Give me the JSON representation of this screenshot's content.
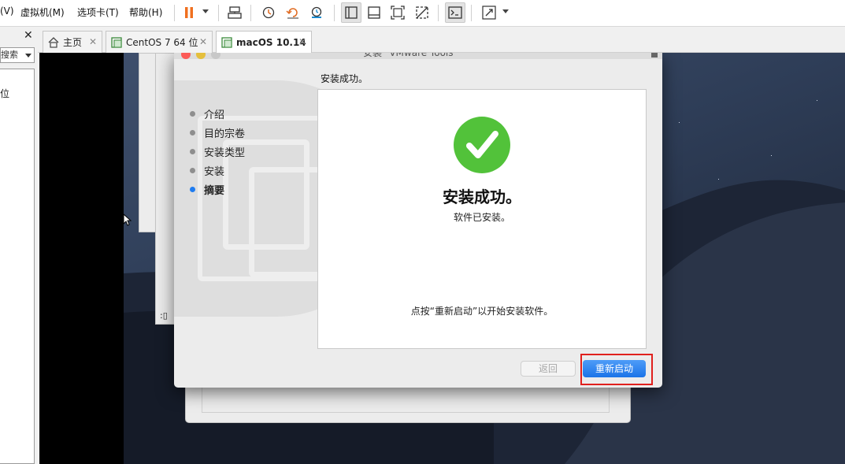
{
  "menu": {
    "items": [
      "(V)",
      "虚拟机(M)",
      "选项卡(T)",
      "帮助(H)"
    ]
  },
  "toolbar": {
    "icons": [
      "pause-icon",
      "send-keys-icon",
      "snapshot-icon",
      "revert-snapshot-icon",
      "snapshot-manager-icon",
      "normal-view-icon",
      "console-view-icon",
      "full-screen-icon",
      "unity-icon",
      "terminal-icon",
      "stretch-icon"
    ]
  },
  "library": {
    "search_placeholder": "搜索",
    "tree_item": "位"
  },
  "tabs": [
    {
      "label": "主页",
      "active": false
    },
    {
      "label": "CentOS 7 64 位",
      "active": false
    },
    {
      "label": "macOS 10.14",
      "active": true
    }
  ],
  "installer": {
    "window_title": "安装 \"VMware Tools\"",
    "heading": "安装成功。",
    "steps": [
      {
        "label": "介绍",
        "current": false
      },
      {
        "label": "目的宗卷",
        "current": false
      },
      {
        "label": "安装类型",
        "current": false
      },
      {
        "label": "安装",
        "current": false
      },
      {
        "label": "摘要",
        "current": true
      }
    ],
    "panel_title": "安装成功。",
    "panel_subtitle": "软件已安装。",
    "panel_note": "点按“重新启动”以开始安装软件。",
    "back_button": "返回",
    "restart_button": "重新启动"
  },
  "bg_window_text": ":▯",
  "colors": {
    "success_green": "#52c23a",
    "primary_blue": "#1b74e8",
    "highlight_red": "#e0201d",
    "pause_orange": "#f07020"
  }
}
